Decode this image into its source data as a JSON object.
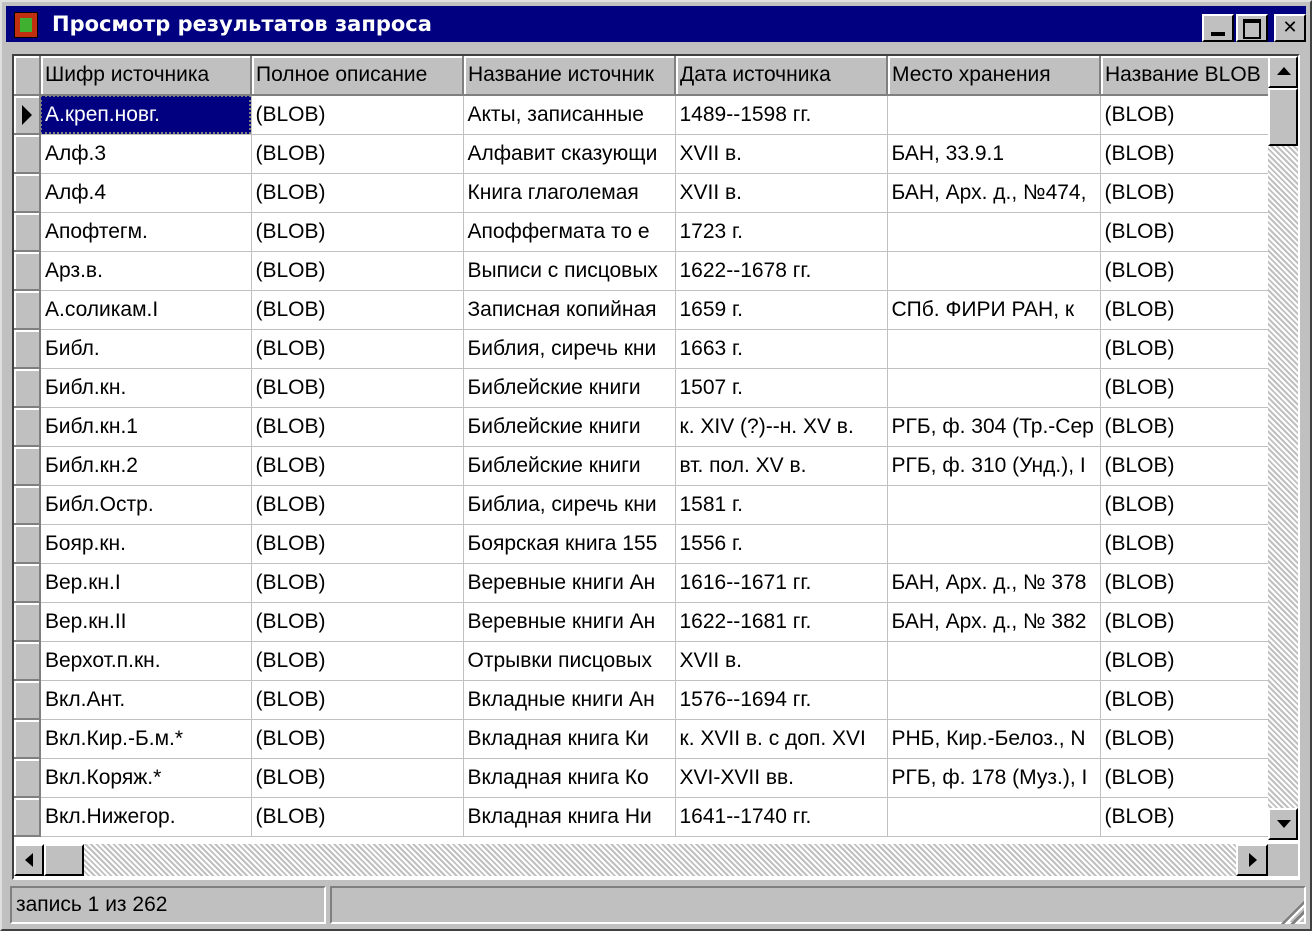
{
  "window": {
    "title": "Просмотр результатов запроса"
  },
  "grid": {
    "columns": [
      "Шифр источника",
      "Полное описание",
      "Название источник",
      "Дата источника",
      "Место хранения",
      "Название BLOB"
    ],
    "rows": [
      [
        "А.креп.новг.",
        "(BLOB)",
        "Акты, записанные",
        "1489--1598 гг.",
        "",
        "(BLOB)"
      ],
      [
        "Алф.3",
        "(BLOB)",
        "Алфавит сказующи",
        "XVII в.",
        "БАН, 33.9.1",
        "(BLOB)"
      ],
      [
        "Алф.4",
        "(BLOB)",
        "Книга глаголемая",
        "XVII в.",
        "БАН, Арх. д., №474,",
        "(BLOB)"
      ],
      [
        "Апофтегм.",
        "(BLOB)",
        "Апоффегмата то е",
        "1723 г.",
        "",
        "(BLOB)"
      ],
      [
        "Арз.в.",
        "(BLOB)",
        "Выписи с писцовых",
        "1622--1678 гг.",
        "",
        "(BLOB)"
      ],
      [
        "А.соликам.I",
        "(BLOB)",
        "Записная копийная",
        "1659 г.",
        "СПб. ФИРИ РАН, к",
        "(BLOB)"
      ],
      [
        "Библ.",
        "(BLOB)",
        "Библия, сиречь кни",
        "1663 г.",
        "",
        "(BLOB)"
      ],
      [
        "Библ.кн.",
        "(BLOB)",
        "Библейские книги",
        "1507 г.",
        "",
        "(BLOB)"
      ],
      [
        "Библ.кн.1",
        "(BLOB)",
        "Библейские книги",
        "к. XIV (?)--н. XV в.",
        "РГБ, ф. 304 (Тр.-Сер",
        "(BLOB)"
      ],
      [
        "Библ.кн.2",
        "(BLOB)",
        "Библейские книги",
        "вт. пол. XV в.",
        "РГБ, ф. 310 (Унд.), I",
        "(BLOB)"
      ],
      [
        "Библ.Остр.",
        "(BLOB)",
        "Библиа, сиречь кни",
        "1581 г.",
        "",
        "(BLOB)"
      ],
      [
        "Бояр.кн.",
        "(BLOB)",
        "Боярская книга 155",
        "1556 г.",
        "",
        "(BLOB)"
      ],
      [
        "Вер.кн.I",
        "(BLOB)",
        "Веревные книги Ан",
        "1616--1671 гг.",
        "БАН, Арх. д., № 378",
        "(BLOB)"
      ],
      [
        "Вер.кн.II",
        "(BLOB)",
        "Веревные книги Ан",
        "1622--1681 гг.",
        "БАН, Арх. д., № 382",
        "(BLOB)"
      ],
      [
        "Верхот.п.кн.",
        "(BLOB)",
        "Отрывки писцовых",
        "XVII в.",
        "",
        "(BLOB)"
      ],
      [
        "Вкл.Ант.",
        "(BLOB)",
        "Вкладные книги Ан",
        "1576--1694 гг.",
        "",
        "(BLOB)"
      ],
      [
        "Вкл.Кир.-Б.м.*",
        "(BLOB)",
        "Вкладная книга Ки",
        "к. XVII в. с доп. XVI",
        "РНБ, Кир.-Белоз., N",
        "(BLOB)"
      ],
      [
        "Вкл.Коряж.*",
        "(BLOB)",
        "Вкладная книга Ко",
        "XVI-XVII вв.",
        "РГБ, ф. 178 (Муз.), I",
        "(BLOB)"
      ],
      [
        "Вкл.Нижегор.",
        "(BLOB)",
        "Вкладная книга Ни",
        "1641--1740 гг.",
        "",
        "(BLOB)"
      ]
    ],
    "selected_row": 0
  },
  "statusbar": {
    "record_text": "запись 1 из 262"
  },
  "colors": {
    "titlebar": "#000080",
    "face": "#c0c0c0",
    "selection": "#000080"
  }
}
